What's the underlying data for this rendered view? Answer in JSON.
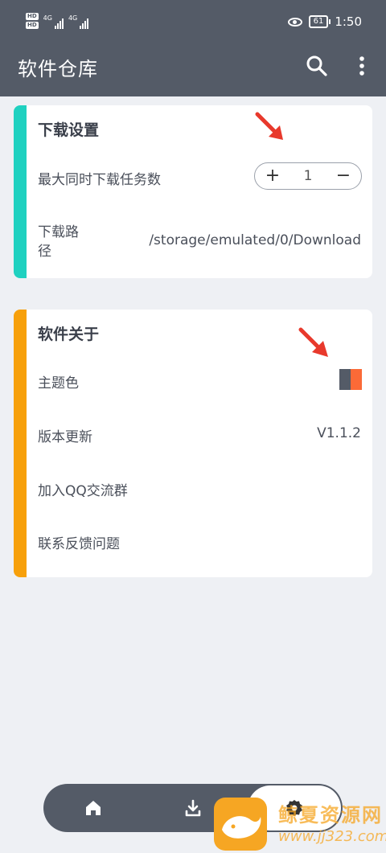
{
  "status_bar": {
    "hd1": "HD",
    "hd2": "HD",
    "net1": "4G",
    "net2": "4G",
    "battery": "61",
    "time": "1:50"
  },
  "app_bar": {
    "title": "软件仓库",
    "search_icon": "search-icon",
    "more_icon": "more-vertical-icon"
  },
  "download_settings": {
    "title": "下载设置",
    "max_tasks_label": "最大同时下载任务数",
    "max_tasks_value": "1",
    "plus": "+",
    "minus": "−",
    "path_label": "下载路径",
    "path_value": "/storage/emulated/0/Download"
  },
  "about": {
    "title": "软件关于",
    "theme_label": "主题色",
    "version_label": "版本更新",
    "version_value": "V1.1.2",
    "qq_group_label": "加入QQ交流群",
    "feedback_label": "联系反馈问题"
  },
  "bottom_nav": {
    "items": [
      {
        "icon": "home-icon"
      },
      {
        "icon": "download-icon"
      },
      {
        "icon": "settings-icon"
      }
    ]
  },
  "watermark": {
    "title": "鲸夏资源网",
    "url": "www.jj323.com"
  },
  "colors": {
    "app_bar": "#545b67",
    "accent_card1": "#1fd1c0",
    "accent_card2": "#f7a00b",
    "theme_swatch_a": "#545b67",
    "theme_swatch_b": "#fb6a37",
    "annotation_arrow": "#e8392c"
  }
}
